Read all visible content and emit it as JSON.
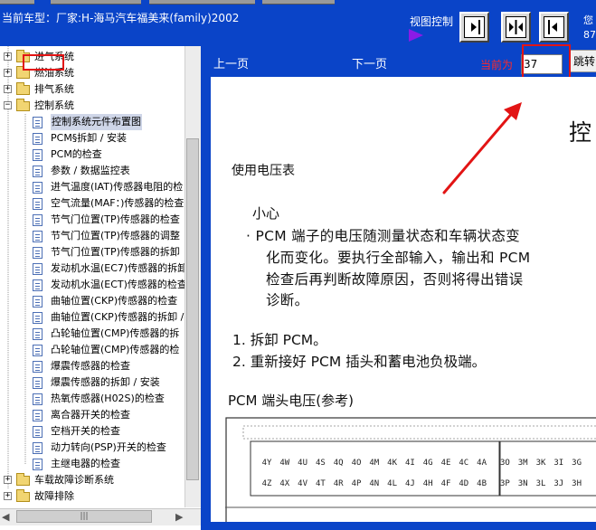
{
  "header": {
    "vehicle_title": "当前车型：厂家:H-海马汽车福美来(family)2002",
    "view_control_label": "视图控制",
    "right_text_1": "您",
    "right_text_2": "87"
  },
  "view_buttons": [
    {
      "name": "view-next-icon",
      "glyph": "▶"
    },
    {
      "name": "view-split-icon",
      "glyph": "◀▶"
    },
    {
      "name": "view-prev-icon",
      "glyph": "◀"
    }
  ],
  "tree": {
    "folders_top": [
      {
        "label": "发动机机械",
        "partial": true
      },
      {
        "label": "进气系统"
      },
      {
        "label": "燃油系统"
      },
      {
        "label": "排气系统"
      },
      {
        "label": "控制系统"
      }
    ],
    "control_items": [
      "控制系统元件布置图",
      "PCM§拆卸 / 安装",
      "PCM的检查",
      "参数 / 数据监控表",
      "进气温度(IAT)传感器电阻的检",
      "空气流量(MAF：)传感器的检查",
      "节气门位置(TP)传感器的检查",
      "节气门位置(TP)传感器的调整",
      "节气门位置(TP)传感器的拆卸",
      "发动机水温(EC7)传感器的拆卸",
      "发动机水温(ECT)传感器的检查",
      "曲轴位置(CKP)传感器的检查",
      "曲轴位置(CKP)传感器的拆卸 /",
      "凸轮轴位置(CMP)传感器的拆",
      "凸轮轴位置(CMP)传感器的检",
      "爆震传感器的检查",
      "爆震传感器的拆卸 / 安装",
      "热氧传感器(H02S)的检查",
      "离合器开关的检查",
      "空档开关的检查",
      "动力转向(PSP)开关的检查",
      "主继电器的检查"
    ],
    "folders_bottom": [
      {
        "label": "车载故障诊断系统"
      },
      {
        "label": "故障排除"
      }
    ],
    "selected_item_index": 0
  },
  "nav": {
    "prev_label": "上一页",
    "next_label": "下一页",
    "current_label": "当前为",
    "page_value": "37",
    "jump_label": "跳转"
  },
  "document": {
    "big_heading": "控",
    "voltage_heading": "使用电压表",
    "caution_title": "小心",
    "caution_lines": [
      "· PCM 端子的电压随测量状态和车辆状态变",
      "化而变化。要执行全部输入，输出和 PCM",
      "检查后再判断故障原因，否则将得出错误",
      "诊断。"
    ],
    "step1": "1. 拆卸 PCM。",
    "step2": "2. 重新接好 PCM 插头和蓄电池负极端。",
    "connector_title": "PCM 端头电压(参考)",
    "pins_row1": [
      "4Y",
      "4W",
      "4U",
      "4S",
      "4Q",
      "4O",
      "4M",
      "4K",
      "4I",
      "4G",
      "4E",
      "4C",
      "4A",
      "3O",
      "3M",
      "3K",
      "3I",
      "3G"
    ],
    "pins_row2": [
      "4Z",
      "4X",
      "4V",
      "4T",
      "4R",
      "4P",
      "4N",
      "4L",
      "4J",
      "4H",
      "4F",
      "4D",
      "4B",
      "3P",
      "3N",
      "3L",
      "3J",
      "3H"
    ]
  },
  "colors": {
    "header_blue": "#0a44c8",
    "highlight_red": "#e21414",
    "current_label_red": "#ff2a2a",
    "arrow_purple": "#8a1be6",
    "folder_yellow": "#f1d572"
  }
}
